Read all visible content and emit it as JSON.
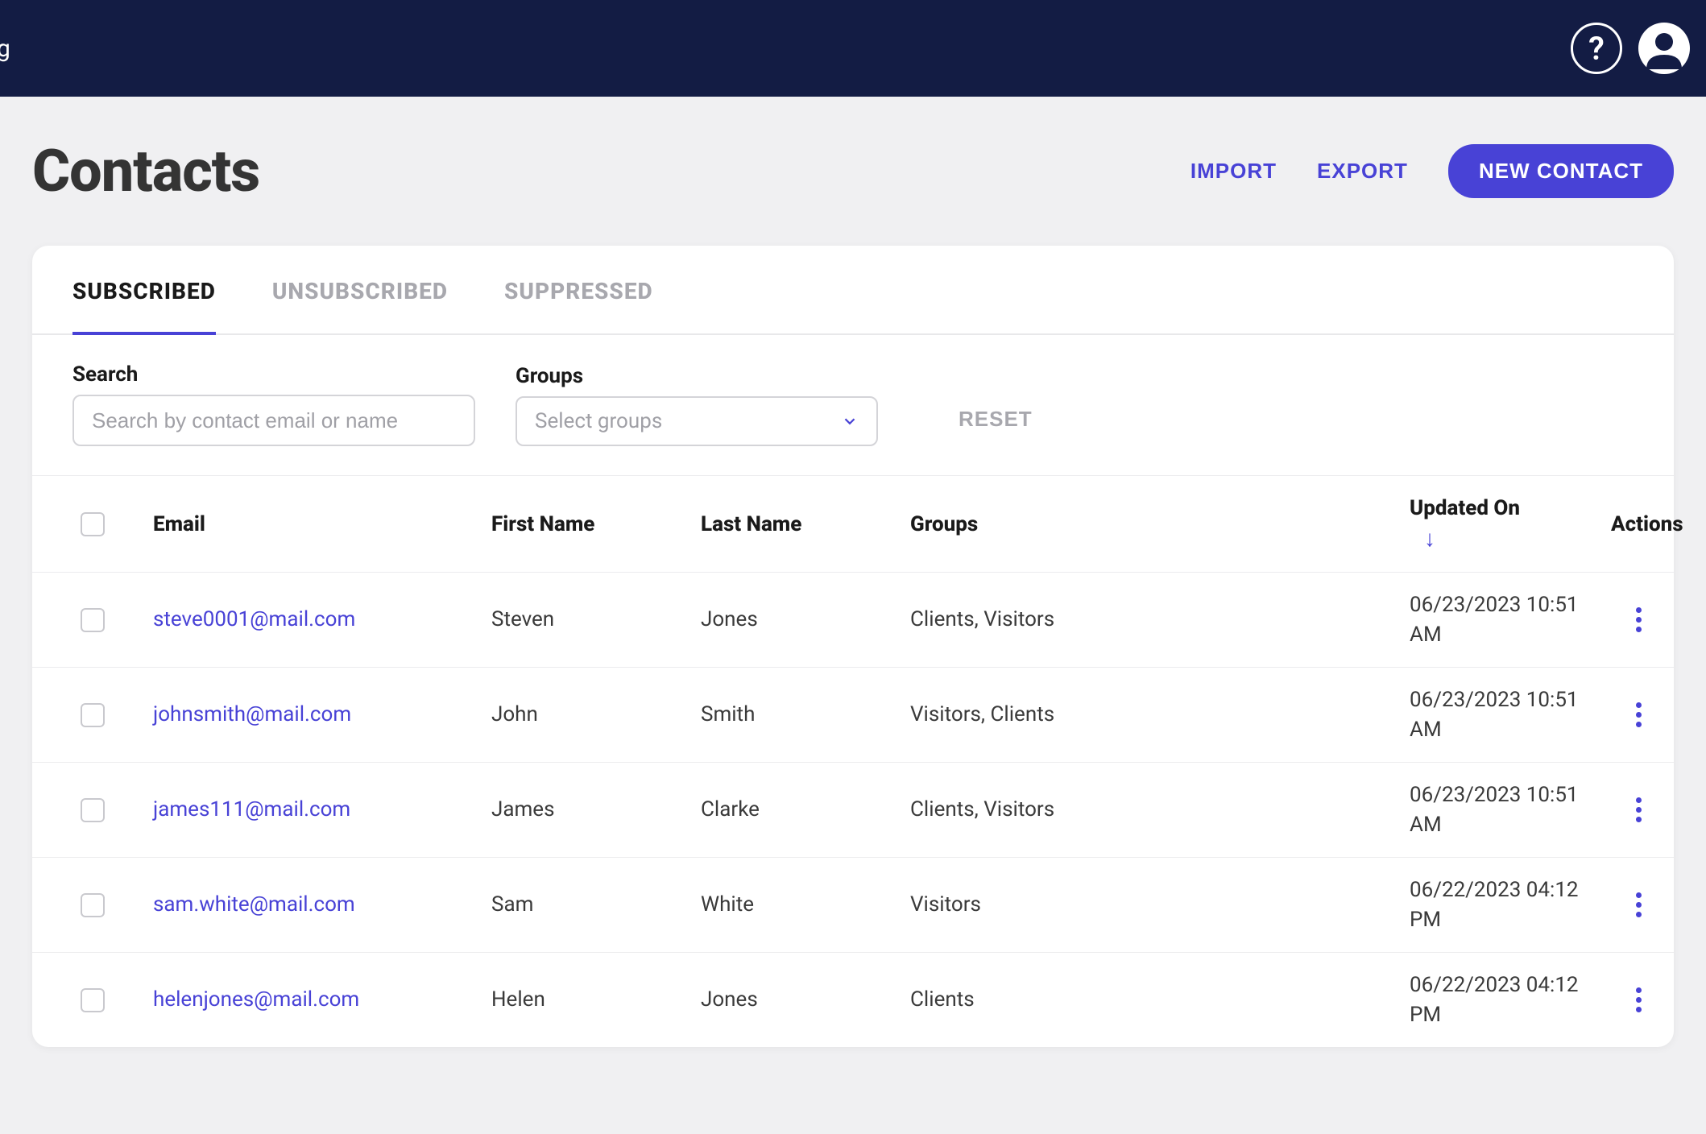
{
  "topbar": {
    "left_fragment": "g"
  },
  "page": {
    "title": "Contacts",
    "import_label": "IMPORT",
    "export_label": "EXPORT",
    "new_contact_label": "NEW CONTACT"
  },
  "tabs": [
    {
      "label": "SUBSCRIBED",
      "active": true
    },
    {
      "label": "UNSUBSCRIBED",
      "active": false
    },
    {
      "label": "SUPPRESSED",
      "active": false
    }
  ],
  "filters": {
    "search_label": "Search",
    "search_placeholder": "Search by contact email or name",
    "groups_label": "Groups",
    "groups_placeholder": "Select groups",
    "reset_label": "RESET"
  },
  "columns": {
    "email": "Email",
    "first_name": "First Name",
    "last_name": "Last Name",
    "groups": "Groups",
    "updated_on": "Updated On",
    "actions": "Actions",
    "sort_indicator": "↓"
  },
  "rows": [
    {
      "email": "steve0001@mail.com",
      "first_name": "Steven",
      "last_name": "Jones",
      "groups": "Clients, Visitors",
      "updated_on": "06/23/2023 10:51 AM"
    },
    {
      "email": "johnsmith@mail.com",
      "first_name": "John",
      "last_name": "Smith",
      "groups": "Visitors, Clients",
      "updated_on": "06/23/2023 10:51 AM"
    },
    {
      "email": "james111@mail.com",
      "first_name": "James",
      "last_name": "Clarke",
      "groups": "Clients, Visitors",
      "updated_on": "06/23/2023 10:51 AM"
    },
    {
      "email": "sam.white@mail.com",
      "first_name": "Sam",
      "last_name": "White",
      "groups": "Visitors",
      "updated_on": "06/22/2023 04:12 PM"
    },
    {
      "email": "helenjones@mail.com",
      "first_name": "Helen",
      "last_name": "Jones",
      "groups": "Clients",
      "updated_on": "06/22/2023 04:12 PM"
    }
  ]
}
